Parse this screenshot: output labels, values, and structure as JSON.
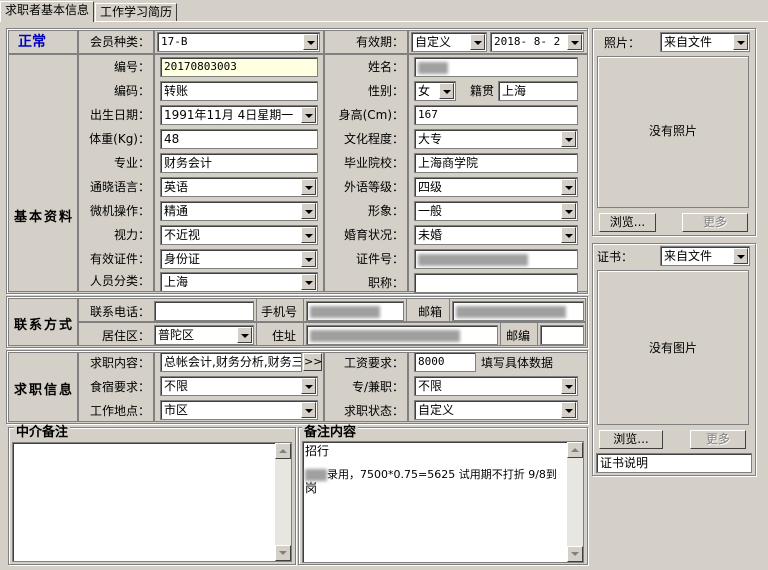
{
  "tabs": [
    {
      "label": "求职者基本信息"
    },
    {
      "label": "工作学习简历"
    }
  ],
  "status": "正常",
  "sections": {
    "basic": "基本资料",
    "contact": "联系方式",
    "job": "求职信息"
  },
  "member": {
    "label": "会员种类：",
    "value": "17-B"
  },
  "validity": {
    "label": "有效期：",
    "type": "自定义",
    "date": "2018- 8- 2"
  },
  "basic": {
    "id_label": "编号：",
    "id_value": "20170803003",
    "code_label": "编码：",
    "code_value": "转账",
    "birth_label": "出生日期：",
    "birth_value": "1991年11月 4日星期一",
    "weight_label": "体重(Kg)：",
    "weight_value": "48",
    "major_label": "专业：",
    "major_value": "财务会计",
    "lang_label": "通晓语言：",
    "lang_value": "英语",
    "computer_label": "微机操作：",
    "computer_value": "精通",
    "vision_label": "视力：",
    "vision_value": "不近视",
    "cert_label": "有效证件：",
    "cert_value": "身份证",
    "cat_label": "人员分类：",
    "cat_value": "上海",
    "name_label": "姓名：",
    "gender_label": "性别：",
    "gender_value": "女",
    "native_label": "籍贯",
    "native_value": "上海",
    "height_label": "身高(Cm)：",
    "height_value": "167",
    "edu_label": "文化程度：",
    "edu_value": "大专",
    "school_label": "毕业院校：",
    "school_value": "上海商学院",
    "foreign_label": "外语等级：",
    "foreign_value": "四级",
    "image_label": "形象：",
    "image_value": "一般",
    "marital_label": "婚育状况：",
    "marital_value": "未婚",
    "certno_label": "证件号：",
    "title_label": "职称："
  },
  "contact": {
    "phone_label": "联系电话：",
    "mobile_label": "手机号",
    "email_label": "邮箱",
    "district_label": "居住区：",
    "district_value": "普陀区",
    "address_label": "住址",
    "zip_label": "邮编"
  },
  "job": {
    "content_label": "求职内容：",
    "content_value": "总帐会计,财务分析,财务三",
    "more_btn": ">>",
    "salary_label": "工资要求：",
    "salary_value": "8000",
    "salary_hint": "填写具体数据",
    "food_label": "食宿要求：",
    "food_value": "不限",
    "parttime_label": "专/兼职：",
    "parttime_value": "不限",
    "location_label": "工作地点：",
    "location_value": "市区",
    "status_label": "求职状态：",
    "status_value": "自定义"
  },
  "photo": {
    "label": "照片：",
    "source": "来自文件",
    "empty": "没有照片",
    "browse": "浏览...",
    "more": "更多"
  },
  "certificate": {
    "label": "证书：",
    "source": "来自文件",
    "empty": "没有图片",
    "browse": "浏览...",
    "more": "更多",
    "desc": "证书说明"
  },
  "notes": {
    "agent_title": "中介备注",
    "remark_title": "备注内容",
    "remark_line1": "招行",
    "remark_line2": "录用，7500*0.75=5625 试用期不打折 9/8到",
    "remark_line3": "岗"
  },
  "colors": {
    "status": "#0000c0",
    "bg": "#d4d0c8"
  }
}
